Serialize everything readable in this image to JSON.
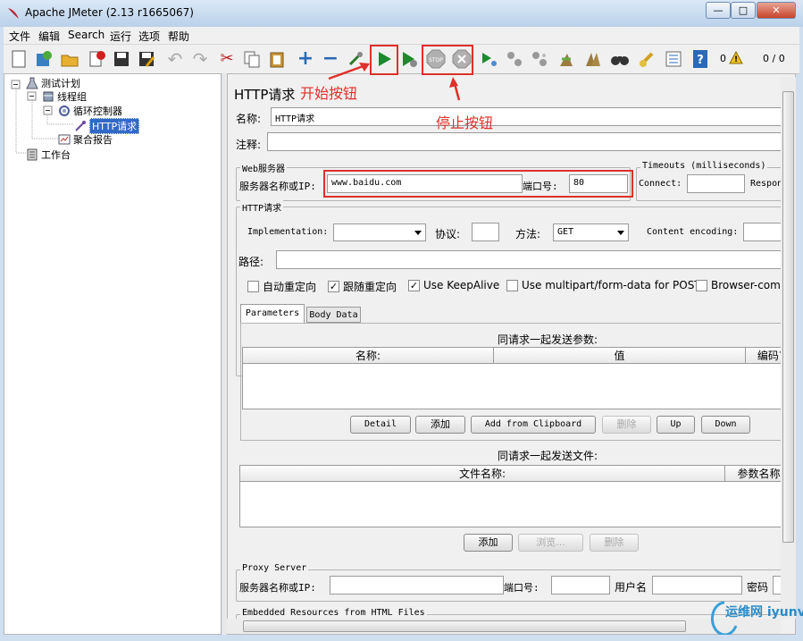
{
  "window": {
    "title": "Apache JMeter (2.13 r1665067)"
  },
  "menu": [
    "文件",
    "编辑",
    "Search",
    "运行",
    "选项",
    "帮助"
  ],
  "toolbar": {
    "warn_count": "0",
    "thread_status": "0 / 0"
  },
  "tree": {
    "items": [
      "测试计划",
      "线程组",
      "循环控制器",
      "HTTP请求",
      "聚合报告",
      "工作台"
    ]
  },
  "panel": {
    "title": "HTTP请求"
  },
  "form": {
    "name_label": "名称:",
    "name_value": "HTTP请求",
    "comment_label": "注释:",
    "webserver_title": "Web服务器",
    "server_label": "服务器名称或IP:",
    "server_value": "www.baidu.com",
    "port_label": "端口号:",
    "port_value": "80",
    "timeouts_title": "Timeouts (milliseconds)",
    "connect_label": "Connect:",
    "response_label": "Respon",
    "http_title": "HTTP请求",
    "impl_label": "Implementation:",
    "protocol_label": "协议:",
    "method_label": "方法:",
    "method_value": "GET",
    "encoding_label": "Content encoding:",
    "path_label": "路径:"
  },
  "checkboxes": [
    {
      "label": "自动重定向",
      "checked": false
    },
    {
      "label": "跟随重定向",
      "checked": true
    },
    {
      "label": "Use KeepAlive",
      "checked": true
    },
    {
      "label": "Use multipart/form-data for POST",
      "checked": false
    },
    {
      "label": "Browser-comp",
      "checked": false
    }
  ],
  "tabs": [
    "Parameters",
    "Body Data"
  ],
  "params": {
    "caption": "同请求一起发送参数:",
    "columns": [
      "名称:",
      "值",
      "编码?"
    ],
    "buttons": [
      "Detail",
      "添加",
      "Add from Clipboard",
      "删除",
      "Up",
      "Down"
    ]
  },
  "files": {
    "caption": "同请求一起发送文件:",
    "columns": [
      "文件名称:",
      "参数名称:"
    ],
    "buttons": [
      "添加",
      "浏览...",
      "删除"
    ]
  },
  "proxy": {
    "title": "Proxy Server",
    "server_label": "服务器名称或IP:",
    "port_label": "端口号:",
    "user_label": "用户名",
    "password_label": "密码"
  },
  "embedded": {
    "title": "Embedded Resources from HTML Files"
  },
  "annotations": {
    "start": "开始按钮",
    "stop": "停止按钮"
  },
  "watermark": "运维网 iyunv.com",
  "colors": {
    "annotation": "#e0302a",
    "start_green": "#1d8a2e",
    "selection": "#3169c6"
  }
}
